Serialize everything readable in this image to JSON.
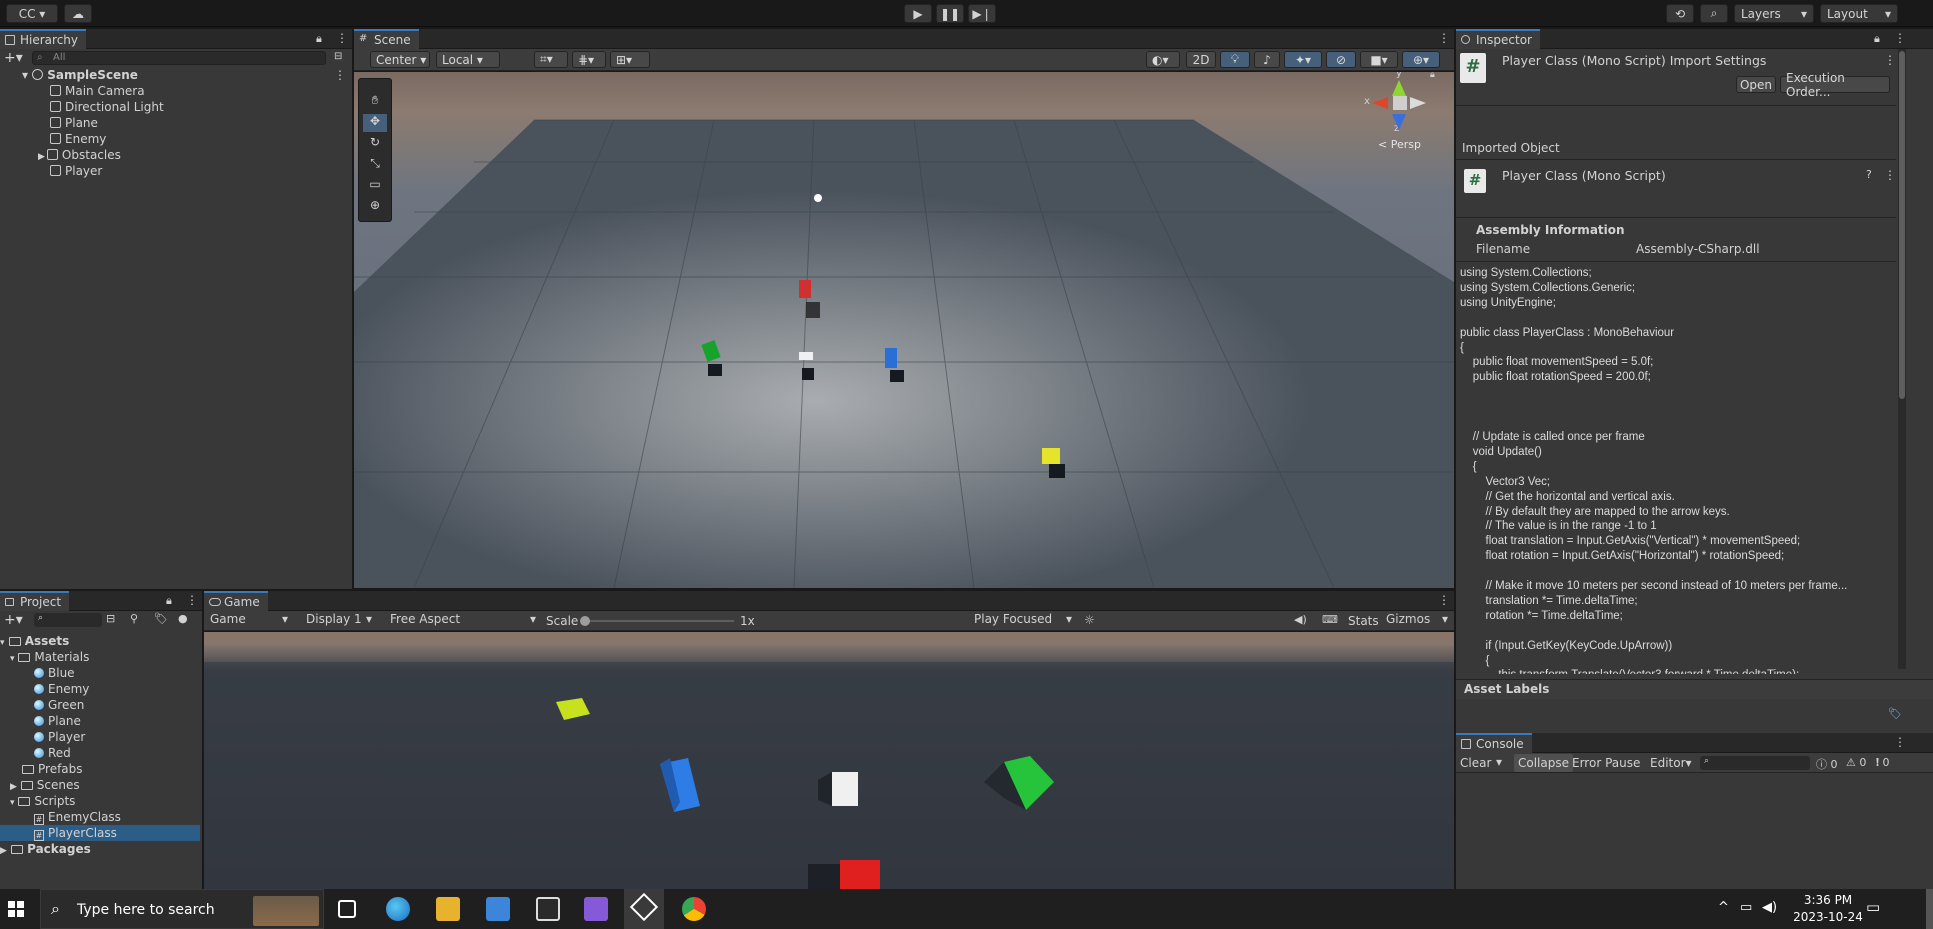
{
  "toolbar": {
    "account": "CC",
    "layers": "Layers",
    "layout": "Layout"
  },
  "hierarchy": {
    "title": "Hierarchy",
    "search_placeholder": "All",
    "scene": "SampleScene",
    "items": [
      "Main Camera",
      "Directional Light",
      "Plane",
      "Enemy",
      "Obstacles",
      "Player"
    ]
  },
  "scene_view": {
    "title": "Scene",
    "pivot": "Center",
    "space": "Local",
    "mode2d": "2D",
    "persp": "< Persp",
    "gizmo_axes": {
      "x": "x",
      "y": "y",
      "z": "z"
    }
  },
  "inspector": {
    "title": "Inspector",
    "header": "Player Class (Mono Script) Import Settings",
    "open": "Open",
    "execution_order": "Execution Order...",
    "imported_object": "Imported Object",
    "object_name": "Player Class (Mono Script)",
    "assembly_info": "Assembly Information",
    "filename_label": "Filename",
    "filename_value": "Assembly-CSharp.dll",
    "code": "using System.Collections;\nusing System.Collections.Generic;\nusing UnityEngine;\n\npublic class PlayerClass : MonoBehaviour\n{\n    public float movementSpeed = 5.0f;\n    public float rotationSpeed = 200.0f;\n\n\n\n    // Update is called once per frame\n    void Update()\n    {\n        Vector3 Vec;\n        // Get the horizontal and vertical axis.\n        // By default they are mapped to the arrow keys.\n        // The value is in the range -1 to 1\n        float translation = Input.GetAxis(\"Vertical\") * movementSpeed;\n        float rotation = Input.GetAxis(\"Horizontal\") * rotationSpeed;\n\n        // Make it move 10 meters per second instead of 10 meters per frame...\n        translation *= Time.deltaTime;\n        rotation *= Time.deltaTime;\n\n        if (Input.GetKey(KeyCode.UpArrow))\n        {\n            this.transform.Translate(Vector3.forward * Time.deltaTime);",
    "asset_labels": "Asset Labels"
  },
  "console": {
    "title": "Console",
    "clear": "Clear",
    "collapse": "Collapse",
    "error_pause": "Error Pause",
    "editor": "Editor",
    "count_log": "0",
    "count_warn": "0",
    "count_err": "0"
  },
  "project": {
    "title": "Project",
    "assets": "Assets",
    "materials": "Materials",
    "material_items": [
      "Blue",
      "Enemy",
      "Green",
      "Plane",
      "Player",
      "Red"
    ],
    "prefabs": "Prefabs",
    "scenes": "Scenes",
    "scripts": "Scripts",
    "script_items": [
      "EnemyClass",
      "PlayerClass"
    ],
    "packages": "Packages"
  },
  "game_view": {
    "title": "Game",
    "display_mode": "Game",
    "display": "Display 1",
    "aspect": "Free Aspect",
    "scale_label": "Scale",
    "scale_value": "1x",
    "play_mode": "Play Focused",
    "stats": "Stats",
    "gizmos": "Gizmos"
  },
  "taskbar": {
    "search_placeholder": "Type here to search",
    "time": "3:36 PM",
    "date": "2023-10-24"
  },
  "colors": {
    "accent": "#3a79bb",
    "selected_row": "#2c5d87",
    "panel": "#383838",
    "toolbar": "#191919"
  }
}
